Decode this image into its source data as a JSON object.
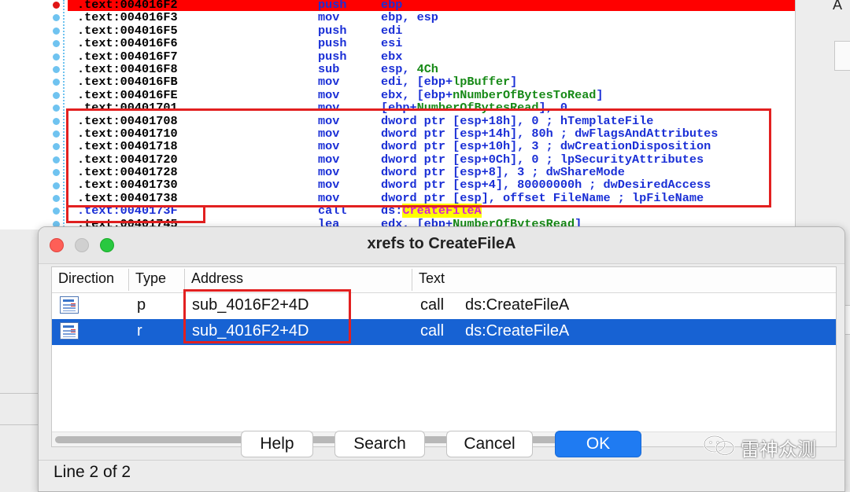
{
  "code_lines": [
    {
      "addr": ".text:004016F2",
      "mnem": "push",
      "ops": [
        {
          "t": "ebp",
          "c": ""
        }
      ]
    },
    {
      "addr": ".text:004016F3",
      "mnem": "mov",
      "ops": [
        {
          "t": "ebp, esp",
          "c": ""
        }
      ]
    },
    {
      "addr": ".text:004016F5",
      "mnem": "push",
      "ops": [
        {
          "t": "edi",
          "c": ""
        }
      ]
    },
    {
      "addr": ".text:004016F6",
      "mnem": "push",
      "ops": [
        {
          "t": "esi",
          "c": ""
        }
      ]
    },
    {
      "addr": ".text:004016F7",
      "mnem": "push",
      "ops": [
        {
          "t": "ebx",
          "c": ""
        }
      ]
    },
    {
      "addr": ".text:004016F8",
      "mnem": "sub",
      "ops": [
        {
          "t": "esp, ",
          "c": ""
        },
        {
          "t": "4Ch",
          "c": "g"
        }
      ]
    },
    {
      "addr": ".text:004016FB",
      "mnem": "mov",
      "ops": [
        {
          "t": "edi, [ebp+",
          "c": ""
        },
        {
          "t": "lpBuffer",
          "c": "g"
        },
        {
          "t": "]",
          "c": ""
        }
      ]
    },
    {
      "addr": ".text:004016FE",
      "mnem": "mov",
      "ops": [
        {
          "t": "ebx, [ebp+",
          "c": ""
        },
        {
          "t": "nNumberOfBytesToRead",
          "c": "g"
        },
        {
          "t": "]",
          "c": ""
        }
      ]
    },
    {
      "addr": ".text:00401701",
      "mnem": "mov",
      "ops": [
        {
          "t": "[ebp+",
          "c": ""
        },
        {
          "t": "NumberOfBytesRead",
          "c": "g"
        },
        {
          "t": "], 0",
          "c": ""
        }
      ]
    },
    {
      "addr": ".text:00401708",
      "mnem": "mov",
      "ops": [
        {
          "t": "dword ptr [esp+18h], 0 ; hTemplateFile",
          "c": ""
        }
      ]
    },
    {
      "addr": ".text:00401710",
      "mnem": "mov",
      "ops": [
        {
          "t": "dword ptr [esp+14h], 80h ; dwFlagsAndAttributes",
          "c": ""
        }
      ]
    },
    {
      "addr": ".text:00401718",
      "mnem": "mov",
      "ops": [
        {
          "t": "dword ptr [esp+10h], 3 ; dwCreationDisposition",
          "c": ""
        }
      ]
    },
    {
      "addr": ".text:00401720",
      "mnem": "mov",
      "ops": [
        {
          "t": "dword ptr [esp+0Ch], 0 ; lpSecurityAttributes",
          "c": ""
        }
      ]
    },
    {
      "addr": ".text:00401728",
      "mnem": "mov",
      "ops": [
        {
          "t": "dword ptr [esp+8], 3 ; dwShareMode",
          "c": ""
        }
      ]
    },
    {
      "addr": ".text:00401730",
      "mnem": "mov",
      "ops": [
        {
          "t": "dword ptr [esp+4], 80000000h ; dwDesiredAccess",
          "c": ""
        }
      ]
    },
    {
      "addr": ".text:00401738",
      "mnem": "mov",
      "ops": [
        {
          "t": "dword ptr [esp], offset FileName ; lpFileName",
          "c": ""
        }
      ]
    },
    {
      "addr": ".text:0040173F",
      "mnem": "call",
      "ops": [
        {
          "t": "ds:",
          "c": ""
        },
        {
          "t": "CreateFileA",
          "c": "hl"
        }
      ]
    },
    {
      "addr": ".text:00401745",
      "mnem": "lea",
      "ops": [
        {
          "t": "edx, [ebp+",
          "c": ""
        },
        {
          "t": "NumberOfBytesRead",
          "c": "g"
        },
        {
          "t": "]",
          "c": ""
        }
      ]
    }
  ],
  "right_panel": {
    "label": "A"
  },
  "dialog": {
    "title": "xrefs to CreateFileA",
    "columns": {
      "direction": "Direction",
      "type": "Type",
      "address": "Address",
      "text": "Text"
    },
    "rows": [
      {
        "type": "p",
        "address": "sub_4016F2+4D",
        "text_op": "call",
        "text_arg": "ds:CreateFileA",
        "selected": false
      },
      {
        "type": "r",
        "address": "sub_4016F2+4D",
        "text_op": "call",
        "text_arg": "ds:CreateFileA",
        "selected": true
      }
    ],
    "buttons": {
      "help": "Help",
      "search": "Search",
      "cancel": "Cancel",
      "ok": "OK"
    },
    "status": "Line 2 of 2"
  },
  "watermark": {
    "text": "雷神众测"
  },
  "colors": {
    "highlight_row": "#ff0000",
    "annotation_box": "#e22020",
    "selection": "#1762d3",
    "default_button": "#1f7bf2"
  }
}
